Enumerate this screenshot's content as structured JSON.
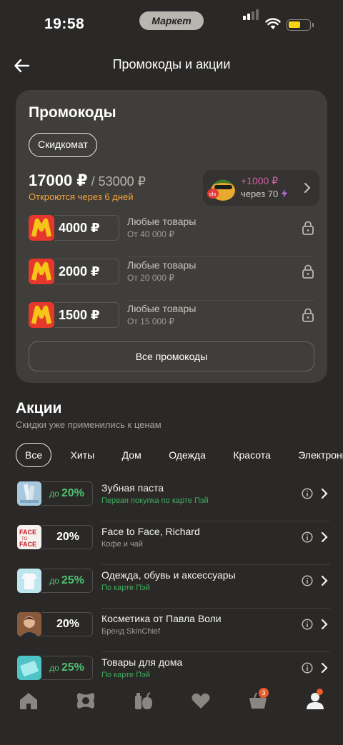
{
  "status": {
    "time": "19:58",
    "app_pill": "Маркет"
  },
  "header": {
    "title": "Промокоды и акции"
  },
  "promo": {
    "title": "Промокоды",
    "chip": "Скидкомат",
    "amount": "17000 ₽",
    "total": " / 53000 ₽",
    "note": "Откроются через 6 дней",
    "bonus_amount": "+1000 ₽",
    "bonus_after": "через 70",
    "coupons": [
      {
        "value": "4000 ₽",
        "title": "Любые товары",
        "subtitle": "От 40 000 ₽"
      },
      {
        "value": "2000 ₽",
        "title": "Любые товары",
        "subtitle": "От 20 000 ₽"
      },
      {
        "value": "1500 ₽",
        "title": "Любые товары",
        "subtitle": "От 15 000 ₽"
      }
    ],
    "all_button": "Все промокоды"
  },
  "actions": {
    "title": "Акции",
    "subtitle": "Скидки уже применились к ценам",
    "tabs": [
      "Все",
      "Хиты",
      "Дом",
      "Одежда",
      "Красота",
      "Электроника"
    ],
    "active_tab": "Все",
    "items": [
      {
        "prefix": "до",
        "discount": "20%",
        "name": "Зубная паста",
        "sub": "Первая покупка по карте Пэй",
        "green": true
      },
      {
        "prefix": "",
        "discount": "20%",
        "name": "Face to Face, Richard",
        "sub": "Кофе и чай",
        "green": false
      },
      {
        "prefix": "до",
        "discount": "25%",
        "name": "Одежда, обувь и аксессуары",
        "sub": "По карте Пэй",
        "green": true
      },
      {
        "prefix": "",
        "discount": "20%",
        "name": "Косметика от Павла Воли",
        "sub": "Бренд SkinChief",
        "green": false
      },
      {
        "prefix": "до",
        "discount": "25%",
        "name": "Товары для дома",
        "sub": "По карте Пэй",
        "green": true
      }
    ]
  },
  "nav": {
    "cart_badge": "3",
    "items": [
      "home-icon",
      "catalog-icon",
      "food-icon",
      "favorites-icon",
      "cart-icon",
      "profile-icon"
    ]
  },
  "colors": {
    "background": "#2b2927",
    "card": "#403e3b",
    "accent_orange": "#f2a03a",
    "green": "#4ec16f",
    "pink": "#d35fa8",
    "logo_red": "#e5372b",
    "logo_yellow": "#f5c518"
  }
}
